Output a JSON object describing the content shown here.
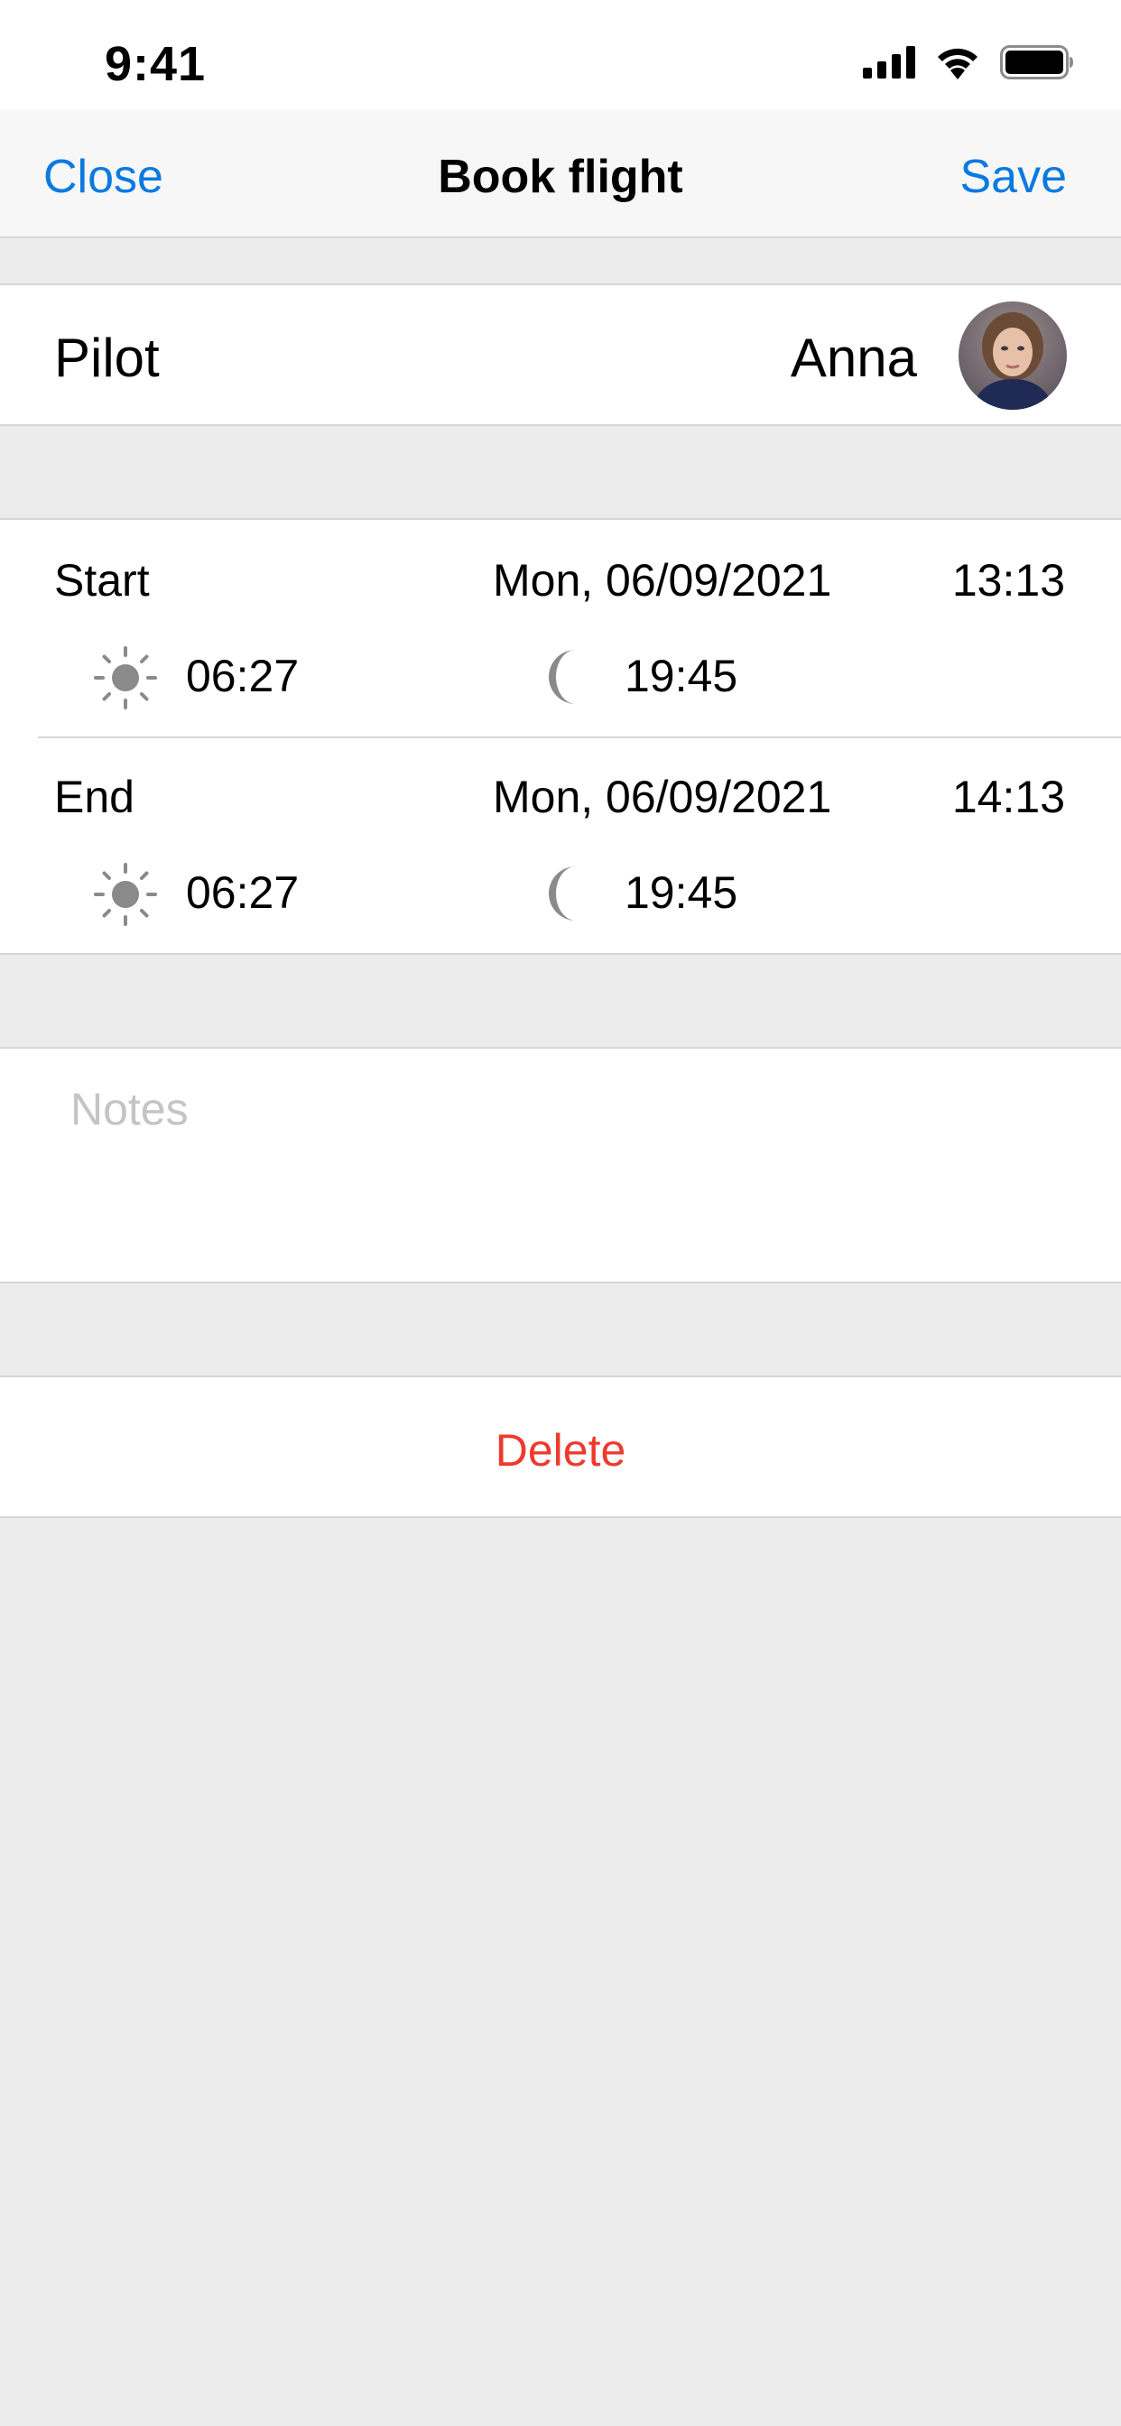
{
  "status_bar": {
    "time": "9:41",
    "icons": [
      "signal-icon",
      "wifi-icon",
      "battery-icon"
    ]
  },
  "nav": {
    "close_label": "Close",
    "title": "Book flight",
    "save_label": "Save"
  },
  "pilot": {
    "label": "Pilot",
    "name": "Anna",
    "avatar_icon": "avatar-photo"
  },
  "schedule": {
    "start": {
      "label": "Start",
      "date": "Mon, 06/09/2021",
      "time": "13:13",
      "sunrise": "06:27",
      "sunset": "19:45"
    },
    "end": {
      "label": "End",
      "date": "Mon, 06/09/2021",
      "time": "14:13",
      "sunrise": "06:27",
      "sunset": "19:45"
    }
  },
  "notes": {
    "value": "",
    "placeholder": "Notes"
  },
  "actions": {
    "delete_label": "Delete"
  },
  "colors": {
    "accent": "#0a7ae0",
    "destructive": "#ee3a2c",
    "background": "#ececec",
    "icon_gray": "#8a8a8a"
  }
}
